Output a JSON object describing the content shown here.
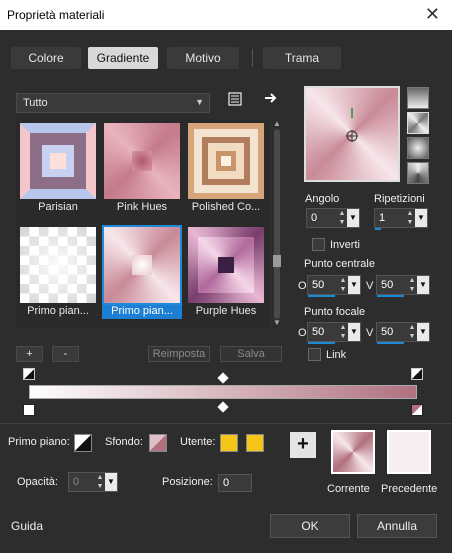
{
  "window": {
    "title": "Proprietà materiali",
    "close": "✕"
  },
  "tabs": [
    {
      "label": "Colore",
      "active": false
    },
    {
      "label": "Gradiente",
      "active": true
    },
    {
      "label": "Motivo",
      "active": false
    },
    {
      "label": "Trama",
      "active": false
    }
  ],
  "library": {
    "category": "Tutto",
    "items": [
      {
        "label": "Parisian",
        "selected": false
      },
      {
        "label": "Pink Hues",
        "selected": false
      },
      {
        "label": "Polished Co...",
        "selected": false
      },
      {
        "label": "Primo pian...",
        "selected": false
      },
      {
        "label": "Primo pian...",
        "selected": true
      },
      {
        "label": "Purple Hues",
        "selected": false
      }
    ],
    "add": "+",
    "remove": "-",
    "reset": "Reimposta",
    "save": "Salva"
  },
  "settings": {
    "angle_label": "Angolo",
    "angle_value": "0",
    "repeats_label": "Ripetizioni",
    "repeats_value": "1",
    "invert_label": "Inverti",
    "center_label": "Punto centrale",
    "center_o_label": "O",
    "center_o": "50",
    "center_v_label": "V",
    "center_v": "50",
    "focal_label": "Punto focale",
    "focal_o_label": "O",
    "focal_o": "50",
    "focal_v_label": "V",
    "focal_v": "50",
    "link_label": "Link"
  },
  "bottom": {
    "foreground_label": "Primo piano:",
    "background_label": "Sfondo:",
    "user_label": "Utente:",
    "opacity_label": "Opacità:",
    "opacity_value": "0",
    "position_label": "Posizione:",
    "position_value": "0",
    "current_label": "Corrente",
    "previous_label": "Precedente",
    "add_icon": "+"
  },
  "footer": {
    "help": "Guida",
    "ok": "OK",
    "cancel": "Annulla"
  },
  "colors": {
    "accent": "#1d8bd9",
    "user_swatch": "#f5c518",
    "gradient_start": "#ffffff",
    "gradient_end": "#b0707e"
  }
}
